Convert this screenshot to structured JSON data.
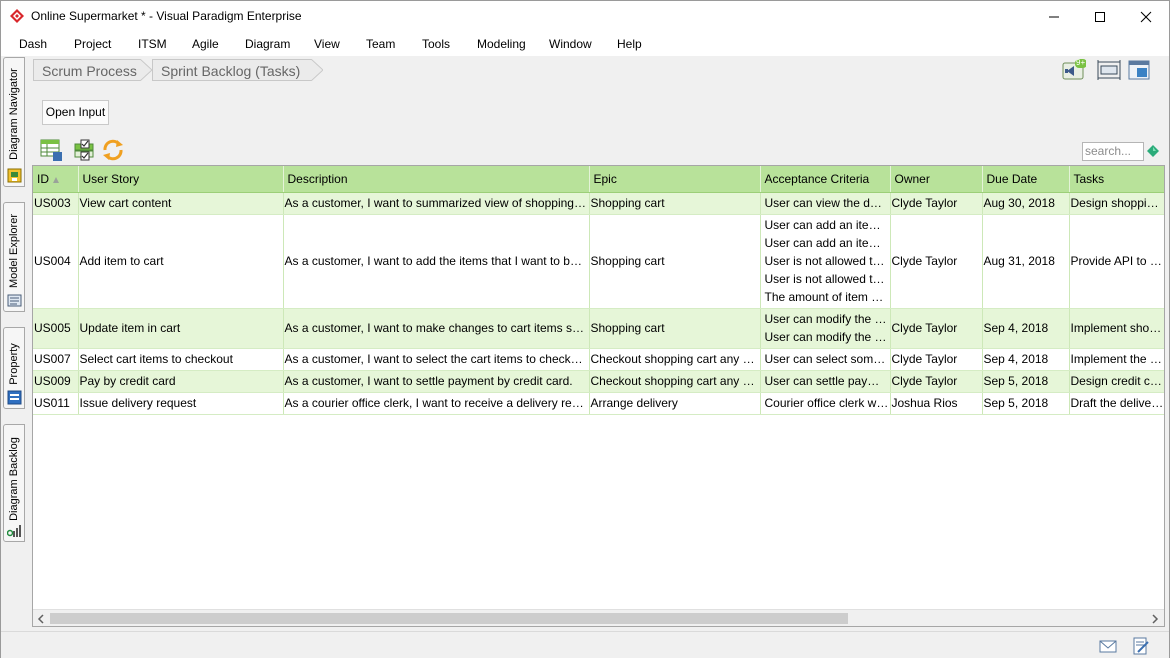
{
  "window": {
    "title": "Online Supermarket * - Visual Paradigm Enterprise",
    "icons": [
      "app-logo-icon",
      "minimize-icon",
      "maximize-icon",
      "close-icon"
    ]
  },
  "menu": {
    "items": [
      "Dash",
      "Project",
      "ITSM",
      "Agile",
      "Diagram",
      "View",
      "Team",
      "Tools",
      "Modeling",
      "Window",
      "Help"
    ]
  },
  "side_tabs": [
    "Diagram Navigator",
    "Model Explorer",
    "Property",
    "Diagram Backlog"
  ],
  "breadcrumb": [
    "Scrum Process",
    "Sprint Backlog (Tasks)"
  ],
  "top_right": {
    "notification_badge": "9+",
    "icons": [
      "notification-icon",
      "fit-diagram-icon",
      "layout-icon"
    ]
  },
  "toolbar": {
    "open_input_label": "Open Input",
    "icons": [
      "table-config-icon",
      "checklist-icon",
      "refresh-icon"
    ],
    "search_placeholder": "search..."
  },
  "table": {
    "columns": [
      "ID",
      "User Story",
      "Description",
      "Epic",
      "Acceptance Criteria",
      "Owner",
      "Due Date",
      "Tasks"
    ],
    "sort_column": "ID",
    "rows": [
      {
        "id": "US003",
        "user_story": "View cart content",
        "description": "As a customer, I want to summarized view of shopping cart.",
        "epic": "Shopping cart",
        "acceptance": [
          "User can view the des..."
        ],
        "owner": "Clyde Taylor",
        "due": "Aug 30, 2018",
        "tasks": "Design shopping c..."
      },
      {
        "id": "US004",
        "user_story": "Add item to cart",
        "description": "As a customer, I want to add the items that I want to buy in...",
        "epic": "Shopping cart",
        "acceptance": [
          "User can add an item i...",
          "User can add an item i...",
          "User is not allowed to ...",
          "User is not allowed to ...",
          "The amount of item all..."
        ],
        "owner": "Clyde Taylor",
        "due": "Aug 31, 2018",
        "tasks": "Provide API to ret..."
      },
      {
        "id": "US005",
        "user_story": "Update item in cart",
        "description": "As a customer, I want to make changes to cart items so that...",
        "epic": "Shopping cart",
        "acceptance": [
          "User can modify the q...",
          "User can modify the pr..."
        ],
        "owner": "Clyde Taylor",
        "due": "Sep 4, 2018",
        "tasks": "Implement shoppi..."
      },
      {
        "id": "US007",
        "user_story": "Select cart items to checkout",
        "description": "As a customer, I want to select the cart items to checkout a...",
        "epic": "Checkout shopping cart any pay",
        "acceptance": [
          "User can select some ..."
        ],
        "owner": "Clyde Taylor",
        "due": "Sep 4, 2018",
        "tasks": "Implement the sh..."
      },
      {
        "id": "US009",
        "user_story": "Pay by credit card",
        "description": "As a customer, I want to settle payment by credit card.",
        "epic": "Checkout shopping cart any pay",
        "acceptance": [
          "User can settle payme..."
        ],
        "owner": "Clyde Taylor",
        "due": "Sep 5, 2018",
        "tasks": "Design credit card..."
      },
      {
        "id": "US011",
        "user_story": "Issue delivery request",
        "description": "As a courier office clerk, I want to receive a delivery request...",
        "epic": "Arrange delivery",
        "acceptance": [
          "Courier office clerk will..."
        ],
        "owner": "Joshua Rios",
        "due": "Sep 5, 2018",
        "tasks": "Draft the delivery..."
      }
    ]
  },
  "statusbar": {
    "icons": [
      "mail-icon",
      "edit-document-icon"
    ]
  },
  "colors": {
    "header_green": "#b8e29a",
    "row_green": "#e6f6d8",
    "accent_red": "#d9262b"
  }
}
